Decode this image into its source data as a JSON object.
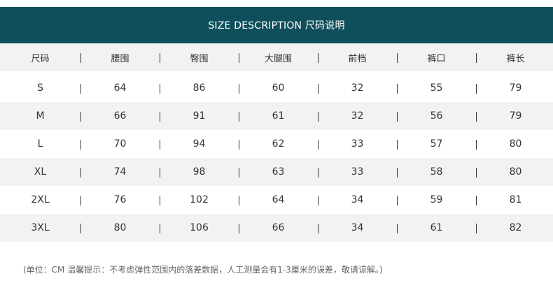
{
  "title": "SIZE DESCRIPTION 尺码说明",
  "table": {
    "headers": [
      "尺码",
      "腰围",
      "臀围",
      "大腿围",
      "前档",
      "裤口",
      "裤长"
    ],
    "rows": [
      [
        "S",
        "64",
        "86",
        "60",
        "32",
        "55",
        "79"
      ],
      [
        "M",
        "66",
        "91",
        "61",
        "32",
        "56",
        "79"
      ],
      [
        "L",
        "70",
        "94",
        "62",
        "33",
        "57",
        "80"
      ],
      [
        "XL",
        "74",
        "98",
        "63",
        "33",
        "58",
        "80"
      ],
      [
        "2XL",
        "76",
        "102",
        "64",
        "34",
        "59",
        "81"
      ],
      [
        "3XL",
        "80",
        "106",
        "66",
        "34",
        "61",
        "82"
      ]
    ]
  },
  "note": "(单位：CM  温馨提示：不考虑弹性范围内的落差数据，人工测量会有1-3厘米的误差，敬请谅解。)",
  "colors": {
    "title_bar": "#0f4f5c",
    "row_shade": "#f2f2f2"
  }
}
